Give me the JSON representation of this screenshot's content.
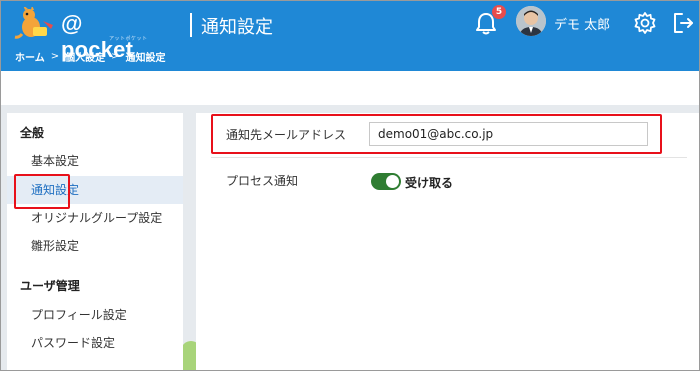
{
  "header": {
    "logo_text": "@ pocket",
    "logo_sub": "アットポケット",
    "page_title": "通知設定",
    "notification_count": "5",
    "user_name": "デモ 太郎",
    "bg_color": "#1f88d6"
  },
  "breadcrumb": {
    "items": [
      "ホーム",
      "個人設定",
      "通知設定"
    ],
    "separator": ">"
  },
  "sidebar": {
    "heading_general": "全般",
    "items_general": [
      "基本設定",
      "通知設定",
      "オリジナルグループ設定",
      "雛形設定"
    ],
    "active_item": "通知設定",
    "heading_users": "ユーザ管理",
    "items_users": [
      "プロフィール設定",
      "パスワード設定"
    ]
  },
  "form": {
    "email_label": "通知先メールアドレス",
    "email_value": "demo01@abc.co.jp",
    "process_label": "プロセス通知",
    "toggle_label": "受け取る",
    "toggle_on": true,
    "toggle_color": "#2f7d32"
  },
  "highlight_color": "#e8101a"
}
